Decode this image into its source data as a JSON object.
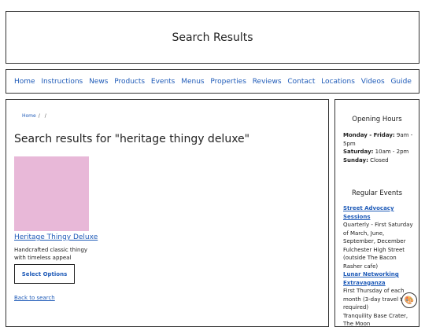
{
  "header": {
    "title": "Search Results"
  },
  "nav": {
    "items": [
      "Home",
      "Instructions",
      "News",
      "Products",
      "Events",
      "Menus",
      "Properties",
      "Reviews",
      "Contact",
      "Locations",
      "Videos",
      "Guide"
    ]
  },
  "breadcrumb": {
    "home": "Home",
    "sep1": "/",
    "sep2": "/"
  },
  "main": {
    "heading": "Search results for \"heritage thingy deluxe\"",
    "product": {
      "name": "Heritage Thingy Deluxe",
      "description": "Handcrafted classic thingy with timeless appeal",
      "button": "Select Options",
      "image_color": "#e8b8d8"
    },
    "back_link": "Back to search"
  },
  "sidebar": {
    "hours_title": "Opening Hours",
    "hours": [
      {
        "day": "Monday - Friday:",
        "time": " 9am - 5pm"
      },
      {
        "day": "Saturday:",
        "time": " 10am - 2pm"
      },
      {
        "day": "Sunday:",
        "time": " Closed"
      }
    ],
    "events_title": "Regular Events",
    "events": [
      {
        "name": "Street Advocacy Sessions",
        "when": "Quarterly - First Saturday of March, June, September, December",
        "where": "Fulchester High Street (outside The Bacon Rasher cafe)"
      },
      {
        "name": "Lunar Networking Extravaganza",
        "when": "First Thursday of each month (3-day travel time required)",
        "where": "Tranquility Base Crater, The Moon"
      }
    ]
  },
  "theme_toggle": {
    "icon": "palette-icon",
    "glyph": "🎨"
  },
  "colors": {
    "link": "#1f5bb8",
    "border": "#333333",
    "product": "#e8b8d8"
  }
}
